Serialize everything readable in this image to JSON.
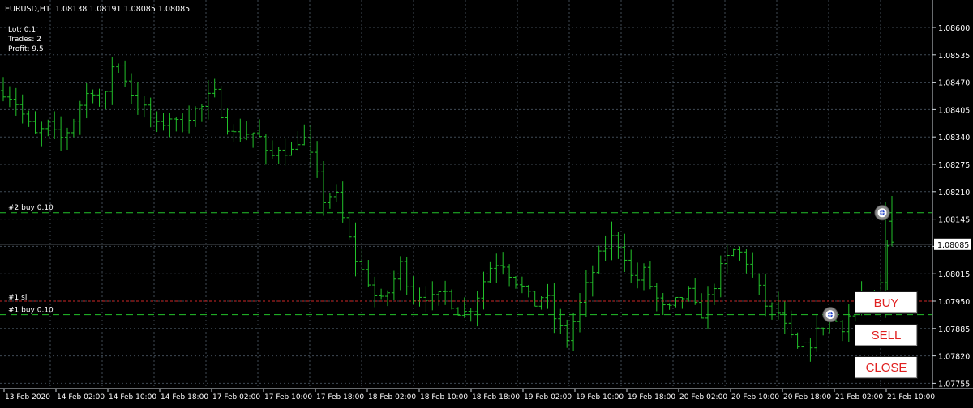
{
  "header": {
    "symbol_tf": "EURUSD,H1",
    "ohlc": "1.08138 1.08191 1.08085 1.08085"
  },
  "info": {
    "lot": "Lot: 0.1",
    "trades": "Trades: 2",
    "profit": "Profit: 9.5"
  },
  "orders": {
    "buy2_label": "#2 buy 0.10",
    "sl1_label": "#1 sl",
    "buy1_label": "#1 buy 0.10"
  },
  "buttons": {
    "buy": "BUY",
    "sell": "SELL",
    "close": "CLOSE"
  },
  "colors": {
    "background": "#000000",
    "bars": "#22c12a",
    "grid": "#3f4a55",
    "text": "#ffffff",
    "order_line": "#22c12a",
    "sl_line": "#d02828",
    "bid_line": "#9aa4ad",
    "price_tag_bg": "#ffffff",
    "button_text": "#e02020"
  },
  "chart_data": {
    "type": "ohlc",
    "timeframe": "H1",
    "ylim": [
      1.07755,
      1.0866
    ],
    "price_ticks": [
      "1.08600",
      "1.08535",
      "1.08470",
      "1.08405",
      "1.08340",
      "1.08275",
      "1.08210",
      "1.08145",
      "1.08080",
      "1.08015",
      "1.07950",
      "1.07885",
      "1.07820",
      "1.07755"
    ],
    "current_price": "1.08085",
    "x_ticks": [
      "13 Feb 2020",
      "14 Feb 02:00",
      "14 Feb 10:00",
      "14 Feb 18:00",
      "17 Feb 02:00",
      "17 Feb 10:00",
      "17 Feb 18:00",
      "18 Feb 02:00",
      "18 Feb 10:00",
      "18 Feb 18:00",
      "19 Feb 02:00",
      "19 Feb 10:00",
      "19 Feb 18:00",
      "20 Feb 02:00",
      "20 Feb 10:00",
      "20 Feb 18:00",
      "21 Feb 02:00",
      "21 Feb 10:00"
    ],
    "order_levels": {
      "buy2": 1.0816,
      "sl1": 1.0795,
      "buy1": 1.07918
    },
    "close_path": [
      1.0845,
      1.0843,
      1.0838,
      1.0834,
      1.0837,
      1.0833,
      1.0836,
      1.0842,
      1.0846,
      1.084,
      1.0853,
      1.0848,
      1.0842,
      1.084,
      1.0836,
      1.0839,
      1.0836,
      1.084,
      1.0841,
      1.0845,
      1.0838,
      1.0834,
      1.0835,
      1.0835,
      1.0828,
      1.0832,
      1.083,
      1.0835,
      1.0828,
      1.0819,
      1.0821,
      1.0812,
      1.0804,
      1.08,
      1.0794,
      1.0798,
      1.0804,
      1.0796,
      1.0797,
      1.0795,
      1.0797,
      1.0793,
      1.0792,
      1.0797,
      1.0803,
      1.0805,
      1.0801,
      1.0798,
      1.0794,
      1.0797,
      1.079,
      1.0786,
      1.0793,
      1.08,
      1.0806,
      1.081,
      1.0808,
      1.0799,
      1.0802,
      1.0796,
      1.0792,
      1.0795,
      1.0797,
      1.0791,
      1.0797,
      1.0803,
      1.0807,
      1.0806,
      1.08,
      1.0794,
      1.0793,
      1.0787,
      1.0783,
      1.0785,
      1.0789,
      1.0791,
      1.0789,
      1.0794,
      1.0797,
      1.0792,
      1.0808
    ]
  }
}
